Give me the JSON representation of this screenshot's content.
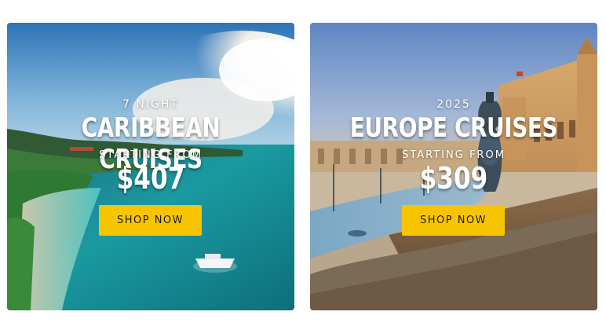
{
  "promos": [
    {
      "eyebrow": "7 NIGHT",
      "title": "CARIBBEAN CRUISES",
      "starting_label": "STARTING FROM",
      "price": "$407",
      "button_label": "SHOP NOW"
    },
    {
      "eyebrow": "2025",
      "title": "EUROPE CRUISES",
      "starting_label": "STARTING FROM",
      "price": "$309",
      "button_label": "SHOP NOW"
    }
  ],
  "colors": {
    "button_bg": "#f7c500",
    "button_text": "#1d1d1d",
    "overlay_text": "#ffffff"
  }
}
